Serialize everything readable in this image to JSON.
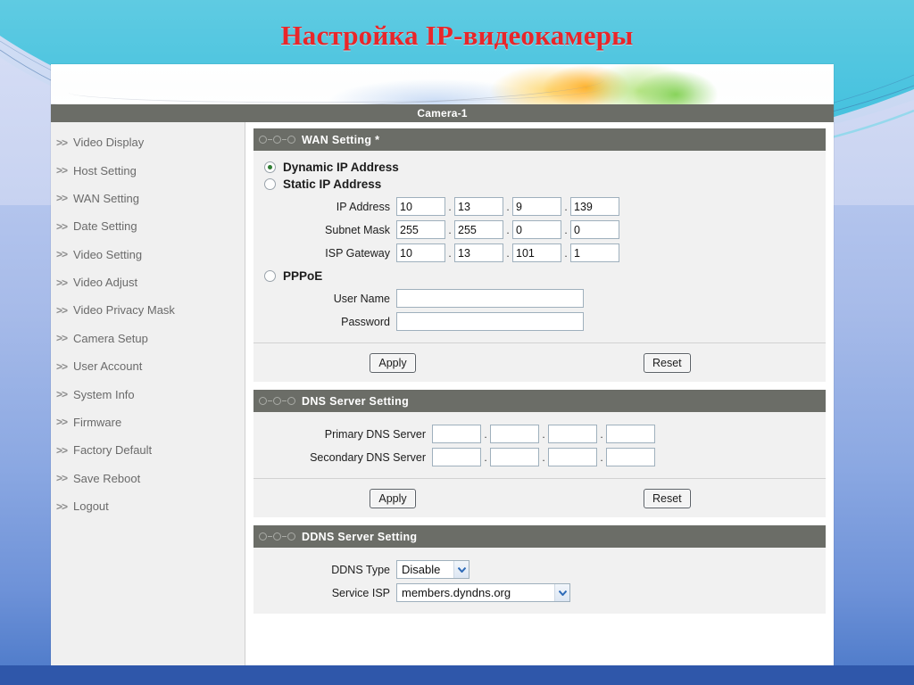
{
  "slide": {
    "title": "Настройка IP-видеокамеры",
    "title_color": "#e8262a",
    "bg_top_color": "#49c3df",
    "bg_bottom_color": "#2f57aa"
  },
  "app": {
    "camera_title": "Camera-1"
  },
  "sidebar": {
    "chevron": ">>",
    "items": [
      {
        "label": "Video Display"
      },
      {
        "label": "Host Setting"
      },
      {
        "label": "WAN Setting"
      },
      {
        "label": "Date Setting"
      },
      {
        "label": "Video Setting"
      },
      {
        "label": "Video Adjust"
      },
      {
        "label": "Video Privacy Mask"
      },
      {
        "label": "Camera Setup"
      },
      {
        "label": "User Account"
      },
      {
        "label": "System Info"
      },
      {
        "label": "Firmware"
      },
      {
        "label": "Factory Default"
      },
      {
        "label": "Save Reboot"
      },
      {
        "label": "Logout"
      }
    ]
  },
  "wan": {
    "header": "WAN Setting *",
    "icon": "chain-link-icon",
    "dynamic_label": "Dynamic IP Address",
    "dynamic_selected": true,
    "static_label": "Static IP Address",
    "static_selected": false,
    "ip_address": {
      "label": "IP Address",
      "octets": [
        "10",
        "13",
        "9",
        "139"
      ]
    },
    "subnet_mask": {
      "label": "Subnet Mask",
      "octets": [
        "255",
        "255",
        "0",
        "0"
      ]
    },
    "isp_gateway": {
      "label": "ISP Gateway",
      "octets": [
        "10",
        "13",
        "101",
        "1"
      ]
    },
    "pppoe_label": "PPPoE",
    "pppoe_selected": false,
    "user_name": {
      "label": "User Name",
      "value": ""
    },
    "password": {
      "label": "Password",
      "value": ""
    },
    "apply_label": "Apply",
    "reset_label": "Reset"
  },
  "dns": {
    "header": "DNS Server Setting",
    "icon": "chain-link-icon",
    "primary": {
      "label": "Primary DNS Server",
      "octets": [
        "",
        "",
        "",
        ""
      ]
    },
    "secondary": {
      "label": "Secondary DNS Server",
      "octets": [
        "",
        "",
        "",
        ""
      ]
    },
    "apply_label": "Apply",
    "reset_label": "Reset"
  },
  "ddns": {
    "header": "DDNS Server Setting",
    "icon": "chain-link-icon",
    "type": {
      "label": "DDNS Type",
      "value": "Disable"
    },
    "service_isp": {
      "label": "Service ISP",
      "value": "members.dyndns.org"
    }
  }
}
